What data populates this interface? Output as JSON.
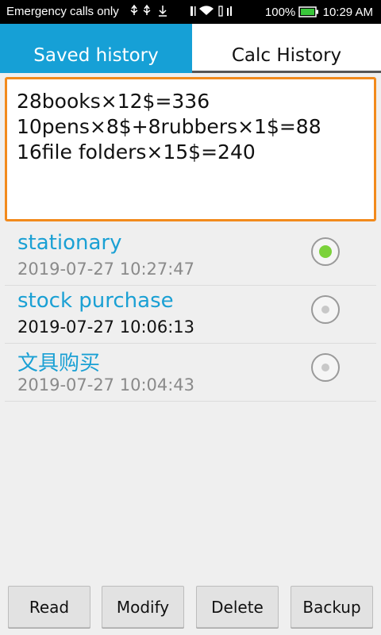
{
  "status_bar": {
    "carrier": "Emergency calls only",
    "battery": "100%",
    "time": "10:29 AM"
  },
  "tabs": {
    "saved": "Saved history",
    "calc": "Calc History",
    "active": "saved"
  },
  "editor": {
    "line1": "28books×12$=336",
    "line2": "10pens×8$+8rubbers×1$=88",
    "line3": "16file folders×15$=240"
  },
  "history": [
    {
      "title": "stationary",
      "date": "2019-07-27 10:27:47",
      "selected": true,
      "date_color": "#8a8a8a"
    },
    {
      "title": "stock purchase",
      "date": "2019-07-27 10:06:13",
      "selected": false,
      "date_color": "#111111"
    },
    {
      "title": "文具购买",
      "date": "2019-07-27 10:04:43",
      "selected": false,
      "date_color": "#8a8a8a"
    }
  ],
  "buttons": {
    "read": "Read",
    "modify": "Modify",
    "delete": "Delete",
    "backup": "Backup"
  },
  "colors": {
    "accent": "#16a0d6",
    "editor_border": "#f28a1c",
    "radio_selected": "#7bd23a"
  }
}
